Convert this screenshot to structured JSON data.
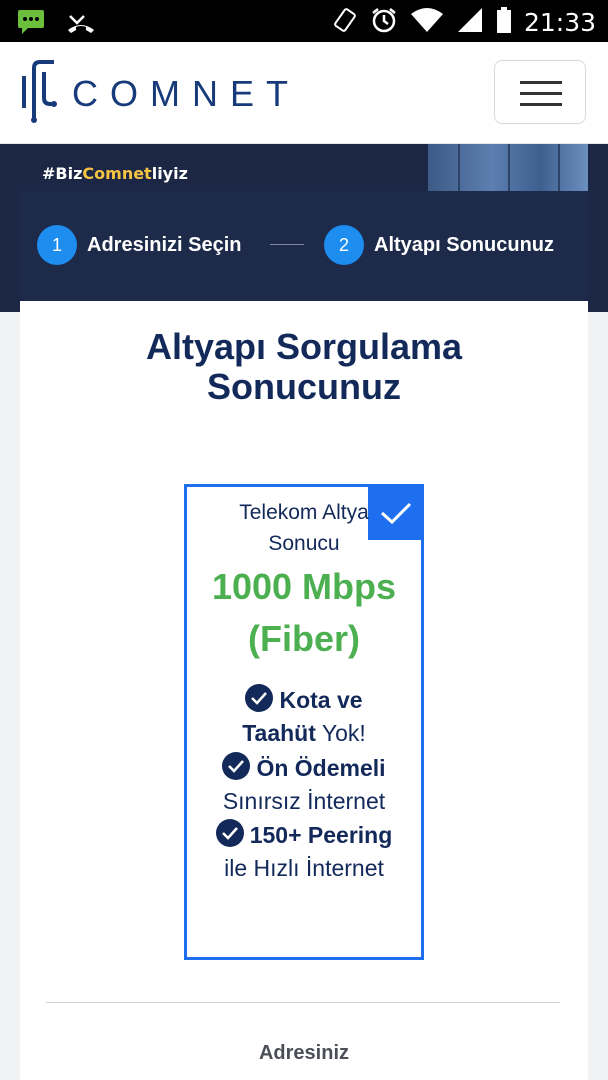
{
  "status_bar": {
    "time": "21:33",
    "icons": [
      "message-icon",
      "missed-call-icon",
      "vibrate-icon",
      "alarm-icon",
      "wifi-icon",
      "signal-icon",
      "battery-icon"
    ]
  },
  "header": {
    "logo_text": "COMNET",
    "menu_icon": "hamburger-icon"
  },
  "banner": {
    "tag_prefix": "#Biz",
    "tag_brand": "Comnet",
    "tag_suffix": "liyiz"
  },
  "steps": [
    {
      "number": "1",
      "label": "Adresinizi Seçin"
    },
    {
      "number": "2",
      "label": "Altyapı Sonucunuz"
    }
  ],
  "page": {
    "title_line1": "Altyapı Sorgulama",
    "title_line2": "Sonucunuz"
  },
  "result": {
    "header_line1": "Telekom Altya",
    "header_line2": "Sonucu",
    "speed_line1": "1000 Mbps",
    "speed_line2": "(Fiber)",
    "features": [
      {
        "bold1": "Kota ve",
        "bold2": "Taahüt",
        "rest": " Yok!"
      },
      {
        "bold1": "Ön Ödemeli",
        "rest": "Sınırsız İnternet"
      },
      {
        "bold1": "150+ Peering",
        "rest": "ile Hızlı İnternet"
      }
    ]
  },
  "address": {
    "label": "Adresiniz"
  },
  "colors": {
    "navy": "#1b2744",
    "primary_blue": "#1e6ef0",
    "step_blue": "#1e8df0",
    "speed_green": "#4caf50",
    "brand_yellow": "#f6c343",
    "title_navy": "#12295a"
  }
}
